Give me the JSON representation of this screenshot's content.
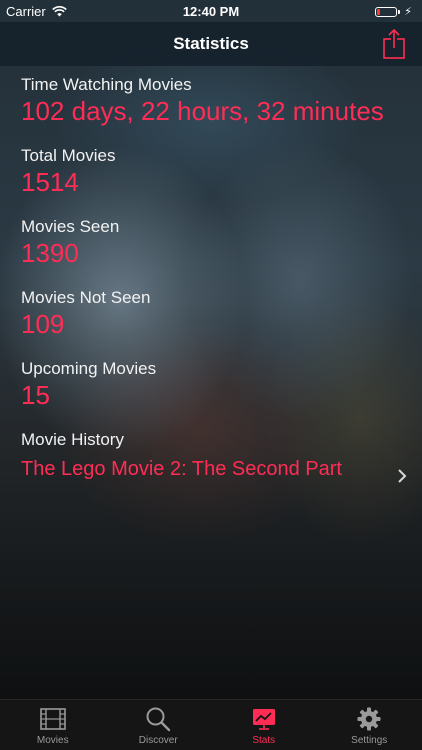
{
  "status_bar": {
    "carrier": "Carrier",
    "time": "12:40 PM"
  },
  "nav": {
    "title": "Statistics"
  },
  "stats": {
    "time_watching": {
      "label": "Time Watching Movies",
      "value": "102 days, 22 hours, 32 minutes"
    },
    "total_movies": {
      "label": "Total Movies",
      "value": "1514"
    },
    "movies_seen": {
      "label": "Movies Seen",
      "value": "1390"
    },
    "movies_not_seen": {
      "label": "Movies Not Seen",
      "value": "109"
    },
    "upcoming_movies": {
      "label": "Upcoming Movies",
      "value": "15"
    },
    "movie_history": {
      "label": "Movie History",
      "value": "The Lego Movie 2: The Second Part"
    }
  },
  "tab_bar": {
    "items": [
      {
        "label": "Movies",
        "icon": "film-icon",
        "active": false
      },
      {
        "label": "Discover",
        "icon": "search-icon",
        "active": false
      },
      {
        "label": "Stats",
        "icon": "chart-icon",
        "active": true
      },
      {
        "label": "Settings",
        "icon": "gear-icon",
        "active": false
      }
    ]
  },
  "colors": {
    "accent": "#ff2d55",
    "nav_background": "#14202a",
    "tab_inactive": "#9a9a9a"
  }
}
